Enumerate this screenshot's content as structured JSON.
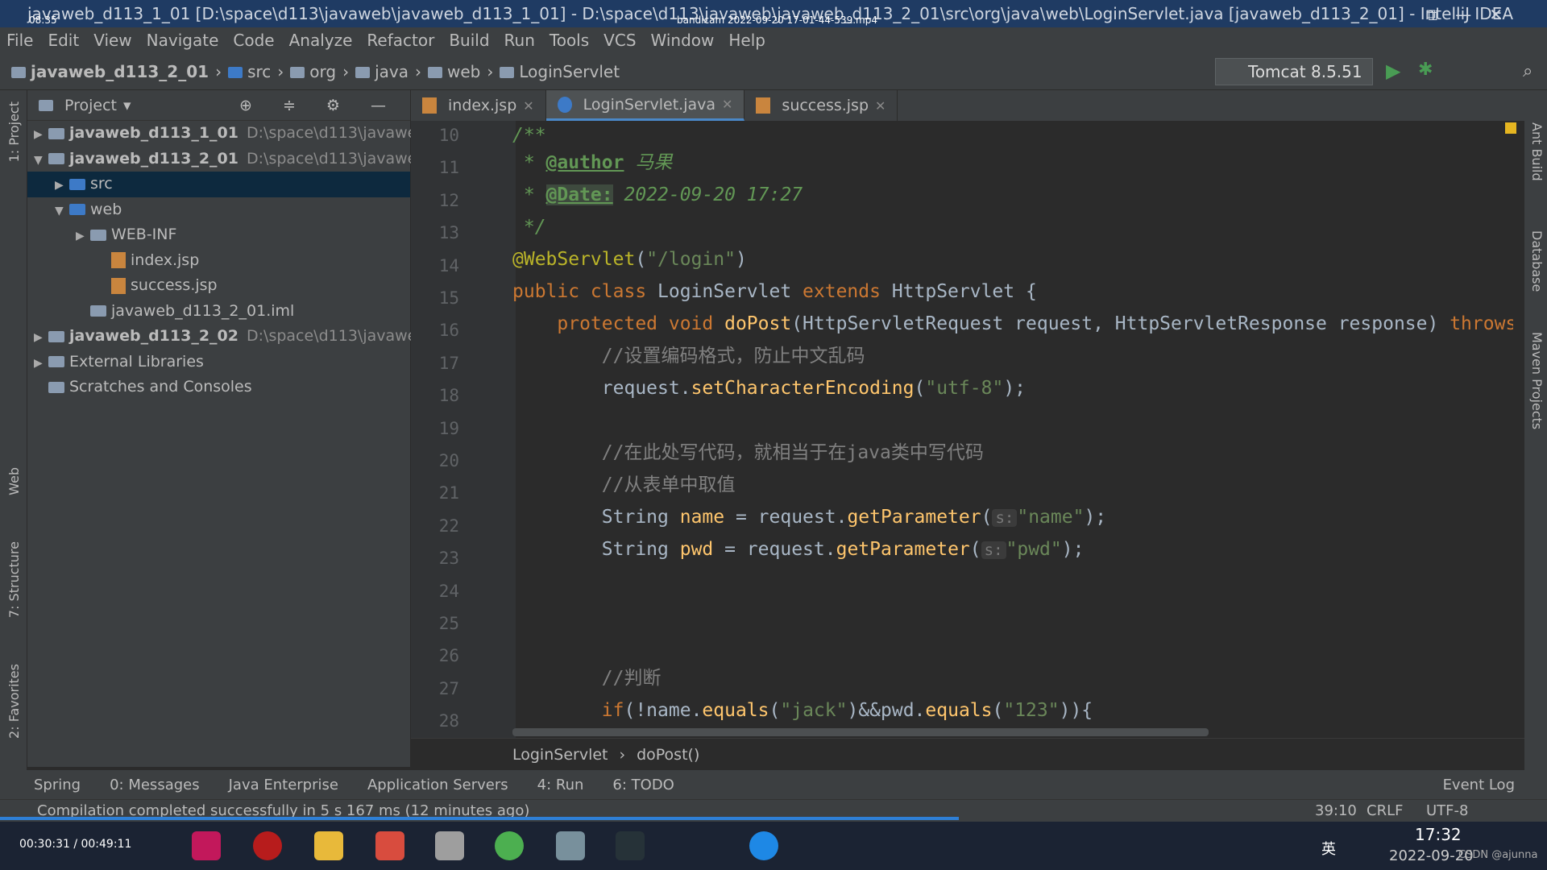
{
  "window": {
    "title": "javaweb_d113_1_01 [D:\\space\\d113\\javaweb\\javaweb_d113_1_01] - D:\\space\\d113\\javaweb\\javaweb_d113_2_01\\src\\org\\java\\web\\LoginServlet.java [javaweb_d113_2_01] - IntelliJ IDEA",
    "rec_time": "08:35",
    "rec_file": "bandicam 2022-09-20 17-01-44-539.mp4"
  },
  "menu": [
    "File",
    "Edit",
    "View",
    "Navigate",
    "Code",
    "Analyze",
    "Refactor",
    "Build",
    "Run",
    "Tools",
    "VCS",
    "Window",
    "Help"
  ],
  "nav": {
    "crumbs": [
      "javaweb_d113_2_01",
      "src",
      "org",
      "java",
      "web",
      "LoginServlet"
    ],
    "run_config": "Tomcat 8.5.51"
  },
  "project": {
    "title": "Project",
    "items": [
      {
        "label": "javaweb_d113_1_01",
        "path": "D:\\space\\d113\\javaweb\\jav"
      },
      {
        "label": "javaweb_d113_2_01",
        "path": "D:\\space\\d113\\javaweb\\jav"
      },
      {
        "label": "src"
      },
      {
        "label": "web"
      },
      {
        "label": "WEB-INF"
      },
      {
        "label": "index.jsp"
      },
      {
        "label": "success.jsp"
      },
      {
        "label": "javaweb_d113_2_01.iml"
      },
      {
        "label": "javaweb_d113_2_02",
        "path": "D:\\space\\d113\\javaweb\\jav"
      },
      {
        "label": "External Libraries"
      },
      {
        "label": "Scratches and Consoles"
      }
    ]
  },
  "side": {
    "left": [
      "1: Project",
      "Web",
      "7: Structure",
      "2: Favorites"
    ],
    "right": [
      "Ant Build",
      "Database",
      "Maven Projects"
    ]
  },
  "tabs": [
    "index.jsp",
    "LoginServlet.java",
    "success.jsp"
  ],
  "lines": [
    "10",
    "11",
    "12",
    "13",
    "14",
    "15",
    "16",
    "17",
    "18",
    "19",
    "20",
    "21",
    "22",
    "23",
    "24",
    "25",
    "26",
    "27",
    "28"
  ],
  "editor_crumbs": [
    "LoginServlet",
    "doPost()"
  ],
  "bottom": [
    "Spring",
    "0: Messages",
    "Java Enterprise",
    "Application Servers",
    "4: Run",
    "6: TODO",
    "Event Log"
  ],
  "status": {
    "msg": "Compilation completed successfully in 5 s 167 ms (12 minutes ago)",
    "pos": "39:10",
    "eol": "CRLF",
    "enc": "UTF-8"
  },
  "taskbar": {
    "player": "00:30:31 / 00:49:11",
    "time": "17:32",
    "date": "2022-09-20",
    "watermark": "CSDN @ajunna",
    "ime": "英"
  }
}
